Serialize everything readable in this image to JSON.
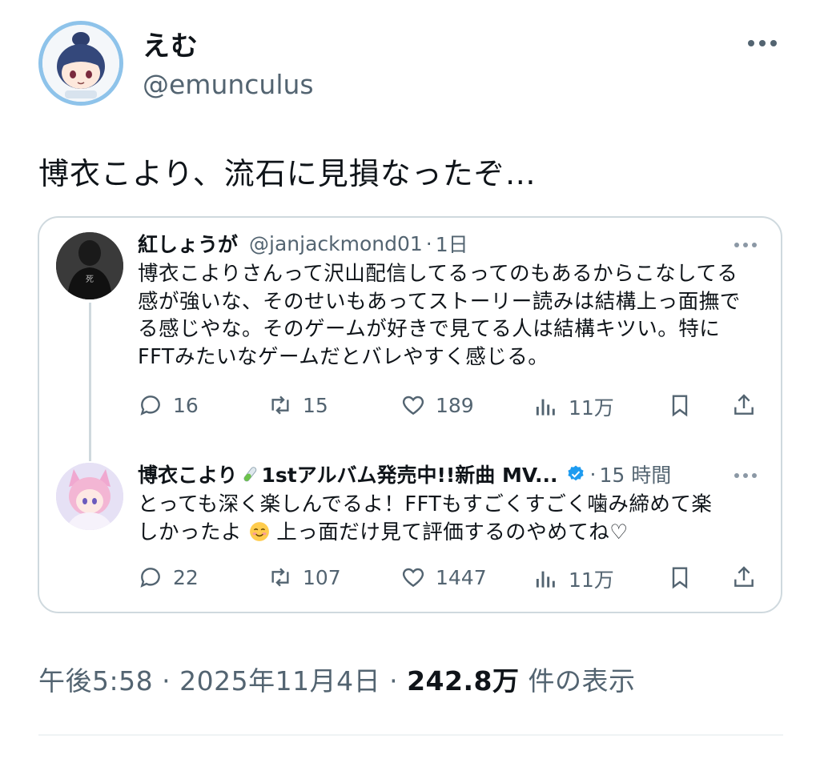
{
  "tweet": {
    "display_name": "えむ",
    "handle": "@emunculus",
    "text": "博衣こより、流石に見損なったぞ…",
    "time": "午後5:58",
    "sep": "·",
    "date": "2025年11月4日",
    "views_count": "242.8万",
    "views_label": "件の表示"
  },
  "quote": {
    "replies": [
      {
        "name": "紅しょうが",
        "handle": "@janjackmond01",
        "sep": "·",
        "time": "1日",
        "lines": [
          "博衣こよりさんって沢山配信してるってのもあるからこなしてる",
          "感が強いな、そのせいもあってストーリー読みは結構上っ面撫で",
          "る感じやな。そのゲームが好きで見てる人は結構キツい。特に",
          "FFTみたいなゲームだとバレやすく感じる。"
        ],
        "stats": {
          "replies": "16",
          "reposts": "15",
          "likes": "189",
          "views": "11万"
        }
      },
      {
        "name": "博衣こより",
        "name_suffix": "1stアルバム発売中!!新曲 MV...",
        "sep": "·",
        "time": "15 時間",
        "lines": [
          "とっても深く楽しんでるよ！FFTもすごくすごく噛み締めて楽",
          "しかったよ",
          "上っ面だけ見て評価するのやめてね♡"
        ],
        "stats": {
          "replies": "22",
          "reposts": "107",
          "likes": "1447",
          "views": "11万"
        }
      }
    ]
  },
  "icons": [
    "more-icon",
    "reply-icon",
    "repost-icon",
    "like-icon",
    "views-icon",
    "bookmark-icon",
    "share-icon",
    "verified-icon",
    "test-tube-emoji",
    "smiling-emoji"
  ],
  "colors": {
    "text": "#0f1419",
    "secondary": "#536471",
    "border": "#cfd9de",
    "verified": "#1d9bf0"
  }
}
